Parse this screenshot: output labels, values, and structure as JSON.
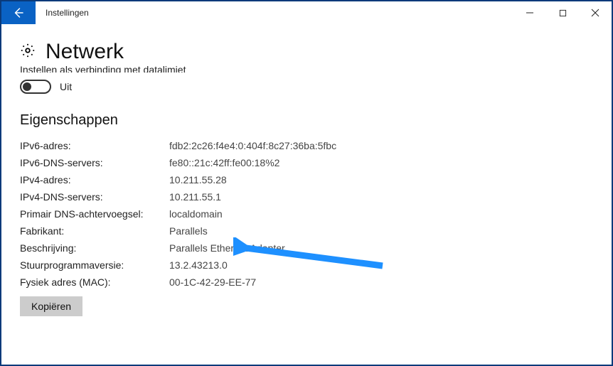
{
  "window": {
    "title": "Instellingen"
  },
  "page": {
    "title": "Netwerk",
    "truncated_line": "Instellen als verbinding met datalimiet"
  },
  "toggle": {
    "state_label": "Uit"
  },
  "section": {
    "heading": "Eigenschappen"
  },
  "props": [
    {
      "label": "IPv6-adres:",
      "value": "fdb2:2c26:f4e4:0:404f:8c27:36ba:5fbc"
    },
    {
      "label": "IPv6-DNS-servers:",
      "value": "fe80::21c:42ff:fe00:18%2"
    },
    {
      "label": "IPv4-adres:",
      "value": "10.211.55.28"
    },
    {
      "label": "IPv4-DNS-servers:",
      "value": "10.211.55.1"
    },
    {
      "label": "Primair DNS-achtervoegsel:",
      "value": "localdomain"
    },
    {
      "label": "Fabrikant:",
      "value": "Parallels"
    },
    {
      "label": "Beschrijving:",
      "value": "Parallels Ethernet Adapter"
    },
    {
      "label": "Stuurprogrammaversie:",
      "value": "13.2.43213.0"
    },
    {
      "label": "Fysiek adres (MAC):",
      "value": "00-1C-42-29-EE-77"
    }
  ],
  "buttons": {
    "copy": "Kopiëren"
  }
}
